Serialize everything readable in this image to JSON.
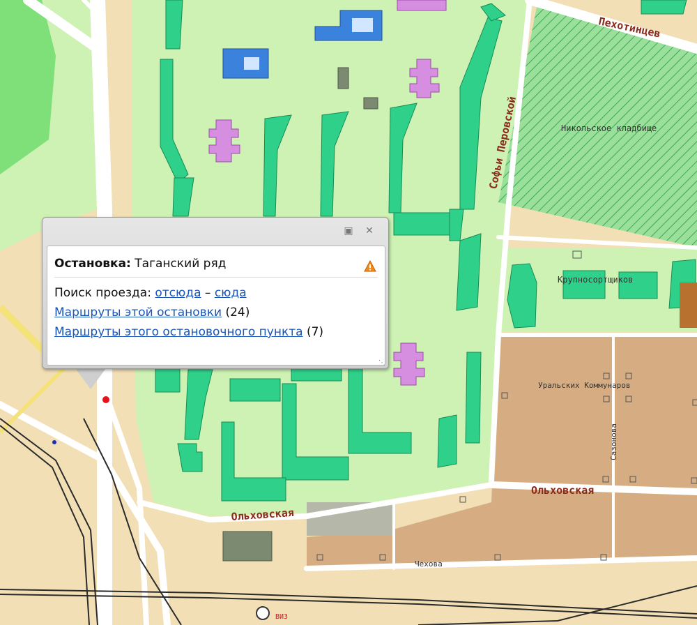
{
  "map": {
    "streets": {
      "pekhotintsev": "Пехотинцев",
      "sofyi_perovskoy": "Софьи Перовской",
      "krupnosortshchikov": "Крупносортщиков",
      "uralskikh_kommunarov": "Уральских Коммунаров",
      "sazonova": "Сазонова",
      "olkhovskaya_right": "Ольховская",
      "olkhovskaya_left": "Ольховская",
      "chekhova": "Чехова",
      "viz": "ВИЗ"
    },
    "areas": {
      "cemetery": "Никольское кладбище"
    },
    "colors": {
      "park": "#cdf2b4",
      "green_building": "#2fd18a",
      "road": "#ffffff",
      "background": "#f2dfb5",
      "private_sector": "#d6ad82",
      "school_building": "#d68fe0",
      "public_building": "#3b82dc",
      "street_label": "#8a2a1a",
      "stop_marker": "#e8101a"
    }
  },
  "popup": {
    "title_label": "Остановка:",
    "title_value": "Таганский ряд",
    "search_label": "Поиск проезда:",
    "link_from": "отсюда",
    "dash": "–",
    "link_to": "сюда",
    "routes_stop_link": "Маршруты этой остановки",
    "routes_stop_count": "(24)",
    "routes_point_link": "Маршруты этого остановочного пункта",
    "routes_point_count": "(7)",
    "warning_icon": "warning-triangle-icon",
    "minimize_icon": "minimize-icon",
    "close_icon": "close-icon",
    "resize_icon": "resize-grip-icon"
  }
}
